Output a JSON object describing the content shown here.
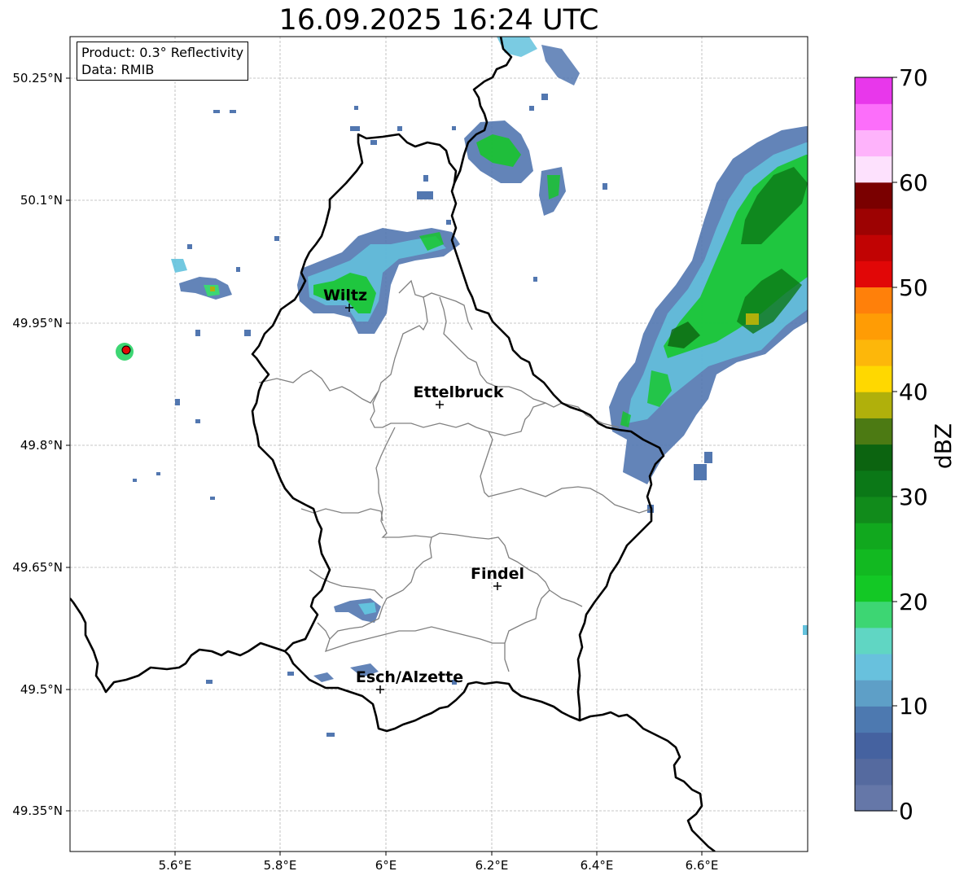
{
  "title": "16.09.2025 16:24 UTC",
  "info_box": {
    "product": "Product: 0.3° Reflectivity",
    "data": "Data: RMIB"
  },
  "axes": {
    "lat_ticks": [
      "50.25°N",
      "50.1°N",
      "49.95°N",
      "49.8°N",
      "49.65°N",
      "49.5°N",
      "49.35°N"
    ],
    "lon_ticks": [
      "5.6°E",
      "5.8°E",
      "6°E",
      "6.2°E",
      "6.4°E",
      "6.6°E"
    ],
    "grid": true
  },
  "cities": [
    {
      "name": "Wiltz"
    },
    {
      "name": "Ettelbruck"
    },
    {
      "name": "Findel"
    },
    {
      "name": "Esch/Alzette"
    }
  ],
  "colorbar": {
    "label": "dBZ",
    "ticks": [
      "0",
      "10",
      "20",
      "30",
      "40",
      "50",
      "60",
      "70"
    ],
    "colors": [
      "#6577a8",
      "#556a9f",
      "#4562a0",
      "#4d79b0",
      "#5e9fc7",
      "#68c1dd",
      "#60d6c3",
      "#3dd673",
      "#13c825",
      "#12b921",
      "#11a81e",
      "#118b1b",
      "#0b7817",
      "#0c6410",
      "#4c7a13",
      "#b0b00b",
      "#ffd800",
      "#fdb70a",
      "#ff9c05",
      "#ff800a",
      "#e10707",
      "#c10303",
      "#9d0202",
      "#7a0000",
      "#fde1fd",
      "#feb3fb",
      "#fc6efa",
      "#e837eb"
    ]
  }
}
